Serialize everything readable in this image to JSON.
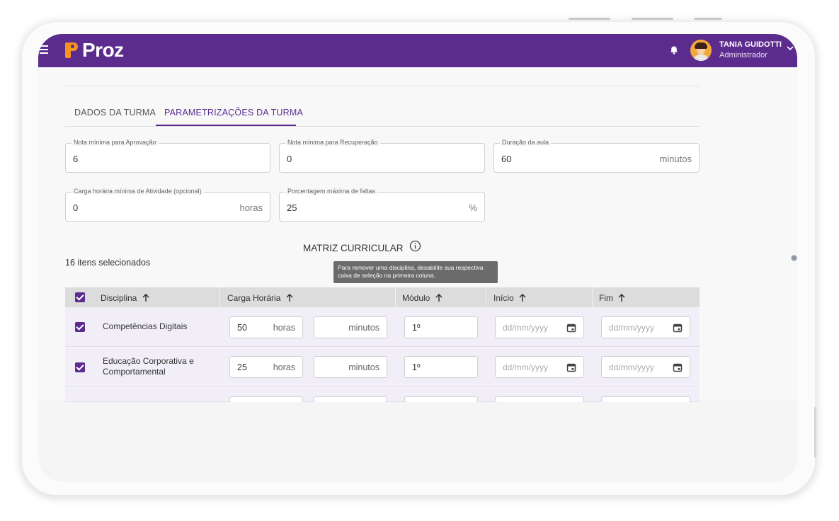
{
  "header": {
    "logo_text": "Proz",
    "user_name": "TANIA GUIDOTTI",
    "user_role": "Administrador"
  },
  "tabs": [
    {
      "label": "DADOS DA TURMA",
      "active": false
    },
    {
      "label": "PARAMETRIZAÇÕES DA TURMA",
      "active": true
    }
  ],
  "fields": {
    "nota_aprovacao": {
      "label": "Nota mínima para Aprovação",
      "value": "6"
    },
    "nota_recuperacao": {
      "label": "Nota mínima para Recuperação",
      "value": "0"
    },
    "duracao_aula": {
      "label": "Duração da aula",
      "value": "60",
      "suffix": "minutos"
    },
    "carga_atividade": {
      "label": "Carga horária mínima de Atividade (opcional)",
      "value": "0",
      "suffix": "horas"
    },
    "porcentagem_faltas": {
      "label": "Porcentagem máxima de faltas",
      "value": "25",
      "suffix": "%"
    }
  },
  "matrix": {
    "title": "MATRIZ CURRICULAR",
    "selected_count": "16 itens selecionados",
    "tooltip": "Para remover uma disciplina, desabilite sua respectiva caixa de seleção na primeira coluna.",
    "columns": [
      "Disciplina",
      "Carga Horária",
      "Módulo",
      "Início",
      "Fim"
    ],
    "rows": [
      {
        "disciplina": "Competências Digitais",
        "horas": "50",
        "horas_suffix": "horas",
        "minutos": "",
        "minutos_suffix": "minutos",
        "modulo": "1º",
        "inicio_placeholder": "dd/mm/yyyy",
        "fim_placeholder": "dd/mm/yyyy",
        "checked": true
      },
      {
        "disciplina": "Educação Corporativa e Comportamental",
        "horas": "25",
        "horas_suffix": "horas",
        "minutos": "",
        "minutos_suffix": "minutos",
        "modulo": "1º",
        "inicio_placeholder": "dd/mm/yyyy",
        "fim_placeholder": "dd/mm/yyyy",
        "checked": true
      }
    ]
  },
  "colors": {
    "brand_purple": "#5b2c8e",
    "brand_orange": "#f7941d",
    "row_bg": "#f1eef7",
    "header_bg": "#dcdcdc"
  },
  "icons": [
    "menu-icon",
    "bell-icon",
    "chevron-down-icon",
    "info-icon",
    "arrow-up-icon",
    "calendar-icon",
    "checkbox-icon"
  ]
}
